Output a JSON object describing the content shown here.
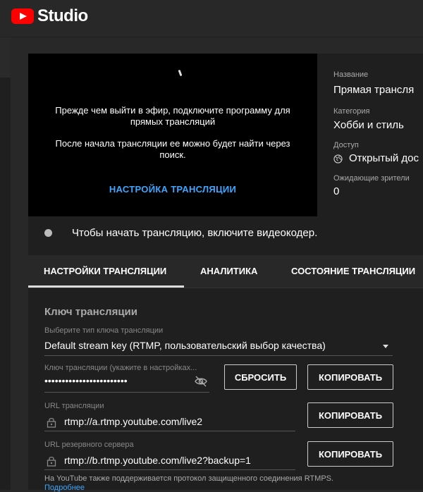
{
  "app": {
    "logo_text": "Studio",
    "brand_color": "#ff0000"
  },
  "video": {
    "message1": "Прежде чем выйти в эфир, подключите программу для прямых трансляций",
    "message2": "После начала трансляции ее можно будет найти через поиск.",
    "setup_link": "НАСТРОЙКА ТРАНСЛЯЦИИ"
  },
  "info": {
    "title_label": "Название",
    "title_value": "Прямая трансля",
    "category_label": "Категория",
    "category_value": "Хобби и стиль",
    "access_label": "Доступ",
    "access_value": "Открытый дос",
    "viewers_label": "Ожидающие зрители",
    "viewers_value": "0"
  },
  "status": {
    "text": "Чтобы начать трансляцию, включите видеокодер."
  },
  "tabs": [
    {
      "label": "НАСТРОЙКИ ТРАНСЛЯЦИИ",
      "active": true
    },
    {
      "label": "АНАЛИТИКА",
      "active": false
    },
    {
      "label": "СОСТОЯНИЕ ТРАНСЛЯЦИИ",
      "active": false
    }
  ],
  "settings": {
    "section_title": "Ключ трансляции",
    "key_type_label": "Выберите тип ключа трансляции",
    "key_type_value": "Default stream key (RTMP, пользовательский выбор качества)",
    "key_label": "Ключ трансляции (укажите в настройках...",
    "key_value": "••••••••••••••••••••••••",
    "reset_button": "СБРОСИТЬ",
    "copy_button": "КОПИРОВАТЬ",
    "url_label": "URL трансляции",
    "url_value": "rtmp://a.rtmp.youtube.com/live2",
    "backup_label": "URL резервного сервера",
    "backup_value": "rtmp://b.rtmp.youtube.com/live2?backup=1",
    "footnote": "На YouTube также поддерживается протокол защищенного соединения RTMPS.",
    "more_link": "Подробнее"
  },
  "colors": {
    "accent": "#3ea6ff",
    "background": "#282828",
    "panel": "#1f1f1f"
  }
}
